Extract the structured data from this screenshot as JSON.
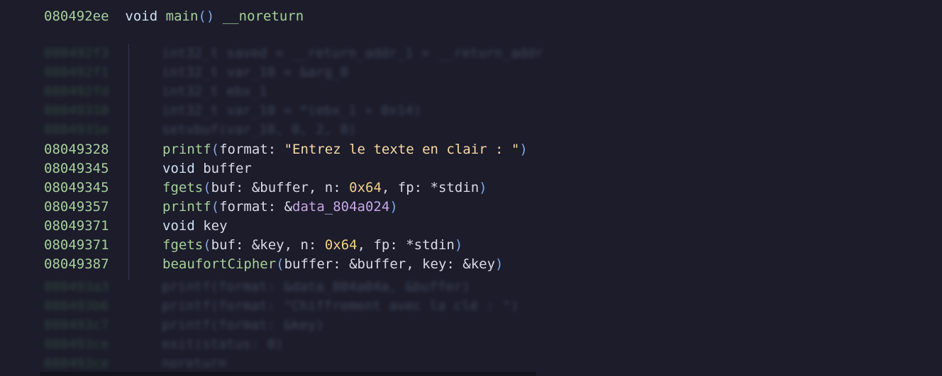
{
  "header": {
    "address": "080492ee",
    "keyword": "void",
    "name": "main",
    "open_paren": "(",
    "close_paren": ")",
    "attribute": "__noreturn"
  },
  "blurred_top": [
    {
      "address": "080492f3",
      "code": "int32_t saved = __return_addr_1 = __return_addr"
    },
    {
      "address": "080492f1",
      "code": "int32_t var_10 = &arg_0"
    },
    {
      "address": "080492fd",
      "code": "int32_t ebx_1"
    },
    {
      "address": "08049310",
      "code": "int32_t var_10 = *(ebx_1 + 0x14)"
    },
    {
      "address": "0804931e",
      "code": "setvbuf(var_10, 0, 2, 0)"
    }
  ],
  "lines": [
    {
      "address": "08049328",
      "parts": [
        {
          "t": "fn",
          "v": "printf"
        },
        {
          "t": "paren",
          "v": "("
        },
        {
          "t": "plain",
          "v": "format: "
        },
        {
          "t": "str",
          "v": "\"Entrez le texte en clair : \""
        },
        {
          "t": "paren",
          "v": ")"
        }
      ]
    },
    {
      "address": "08049345",
      "parts": [
        {
          "t": "kw",
          "v": "void"
        },
        {
          "t": "plain",
          "v": " buffer"
        }
      ]
    },
    {
      "address": "08049345",
      "parts": [
        {
          "t": "fn",
          "v": "fgets"
        },
        {
          "t": "paren",
          "v": "("
        },
        {
          "t": "plain",
          "v": "buf: &buffer, n: "
        },
        {
          "t": "num",
          "v": "0x64"
        },
        {
          "t": "plain",
          "v": ", fp: *stdin"
        },
        {
          "t": "paren",
          "v": ")"
        }
      ]
    },
    {
      "address": "08049357",
      "parts": [
        {
          "t": "fn",
          "v": "printf"
        },
        {
          "t": "paren",
          "v": "("
        },
        {
          "t": "plain",
          "v": "format: &"
        },
        {
          "t": "var",
          "v": "data_804a024"
        },
        {
          "t": "paren",
          "v": ")"
        }
      ]
    },
    {
      "address": "08049371",
      "parts": [
        {
          "t": "kw",
          "v": "void"
        },
        {
          "t": "plain",
          "v": " key"
        }
      ]
    },
    {
      "address": "08049371",
      "parts": [
        {
          "t": "fn",
          "v": "fgets"
        },
        {
          "t": "paren",
          "v": "("
        },
        {
          "t": "plain",
          "v": "buf: &key, n: "
        },
        {
          "t": "num",
          "v": "0x64"
        },
        {
          "t": "plain",
          "v": ", fp: *stdin"
        },
        {
          "t": "paren",
          "v": ")"
        }
      ]
    },
    {
      "address": "08049387",
      "parts": [
        {
          "t": "fn",
          "v": "beaufortCipher"
        },
        {
          "t": "paren",
          "v": "("
        },
        {
          "t": "plain",
          "v": "buffer: &buffer, key: &key"
        },
        {
          "t": "paren",
          "v": ")"
        }
      ]
    }
  ],
  "blurred_bottom": [
    {
      "address": "080493a3",
      "code": "printf(format: &data_804a04a, &buffer)"
    },
    {
      "address": "080493b6",
      "code": "printf(format: \"Chiffrement avec la clé : \")"
    },
    {
      "address": "080493c7",
      "code": "printf(format: &key)"
    },
    {
      "address": "080493ce",
      "code": "exit(status: 0)"
    },
    {
      "address": "080493ce",
      "code": "noreturn"
    }
  ]
}
